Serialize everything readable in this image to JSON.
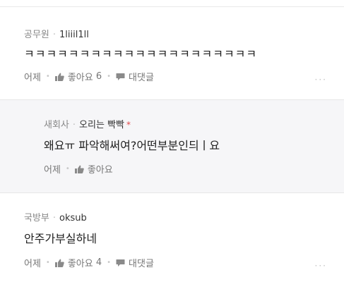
{
  "comments": [
    {
      "affiliation": "공무원",
      "username": "1liiil1ll",
      "text": "ㅋㅋㅋㅋㅋㅋㅋㅋㅋㅋㅋㅋㅋㅋㅋㅋㅋㅋㅋㅋㅋ",
      "time": "어제",
      "like_label": "좋아요",
      "like_count": "6",
      "reply_label": "대댓글",
      "more": "···"
    },
    {
      "affiliation": "새회사",
      "username": "오리는 빡빡",
      "author_mark": "*",
      "text": "왜요ㅠ 파악해써여?어떤부분인듸ㅣ요",
      "time": "어제",
      "like_label": "좋아요"
    },
    {
      "affiliation": "국방부",
      "username": "oksub",
      "text": "안주가부실하네",
      "time": "어제",
      "like_label": "좋아요",
      "like_count": "4",
      "reply_label": "대댓글",
      "more": "···"
    }
  ],
  "colors": {
    "author_mark": "#e24a4a",
    "reply_bg": "#f6f6f8"
  },
  "icons": {
    "like": "thumbs-up-icon",
    "reply": "speech-bubble-icon"
  }
}
